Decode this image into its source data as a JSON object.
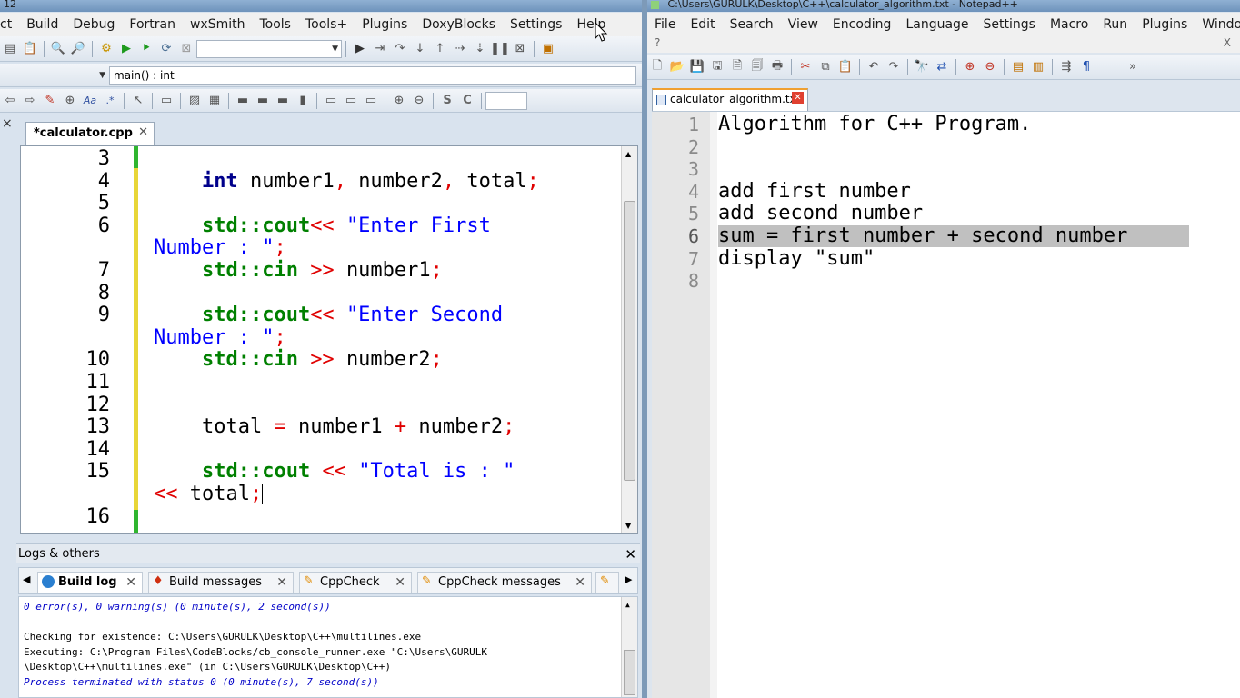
{
  "codeblocks": {
    "title_fragment": "12",
    "menu": [
      "ct",
      "Build",
      "Debug",
      "Fortran",
      "wxSmith",
      "Tools",
      "Tools+",
      "Plugins",
      "DoxyBlocks",
      "Settings",
      "Help"
    ],
    "scope_combo": "main() : int",
    "editor_tab": "*calculator.cpp",
    "code_lines": [
      {
        "num": "3",
        "tokens": []
      },
      {
        "num": "4",
        "tokens": [
          [
            "kw",
            "    int "
          ],
          [
            "txt",
            "number1"
          ],
          [
            "op",
            ", "
          ],
          [
            "txt",
            "number2"
          ],
          [
            "op",
            ", "
          ],
          [
            "txt",
            "total"
          ],
          [
            "op",
            ";"
          ]
        ]
      },
      {
        "num": "5",
        "tokens": []
      },
      {
        "num": "6",
        "tokens": [
          [
            "std",
            "    std::cout"
          ],
          [
            "op",
            "<< "
          ],
          [
            "str",
            "\"Enter First"
          ]
        ]
      },
      {
        "num": "",
        "tokens": [
          [
            "str",
            "Number : \""
          ],
          [
            "op",
            ";"
          ]
        ]
      },
      {
        "num": "7",
        "tokens": [
          [
            "std",
            "    std::cin "
          ],
          [
            "op",
            ">> "
          ],
          [
            "txt",
            "number1"
          ],
          [
            "op",
            ";"
          ]
        ]
      },
      {
        "num": "8",
        "tokens": []
      },
      {
        "num": "9",
        "tokens": [
          [
            "std",
            "    std::cout"
          ],
          [
            "op",
            "<< "
          ],
          [
            "str",
            "\"Enter Second"
          ]
        ]
      },
      {
        "num": "",
        "tokens": [
          [
            "str",
            "Number : \""
          ],
          [
            "op",
            ";"
          ]
        ]
      },
      {
        "num": "10",
        "tokens": [
          [
            "std",
            "    std::cin "
          ],
          [
            "op",
            ">> "
          ],
          [
            "txt",
            "number2"
          ],
          [
            "op",
            ";"
          ]
        ]
      },
      {
        "num": "11",
        "tokens": []
      },
      {
        "num": "12",
        "tokens": []
      },
      {
        "num": "13",
        "tokens": [
          [
            "txt",
            "    total "
          ],
          [
            "op",
            "= "
          ],
          [
            "txt",
            "number1 "
          ],
          [
            "op",
            "+ "
          ],
          [
            "txt",
            "number2"
          ],
          [
            "op",
            ";"
          ]
        ]
      },
      {
        "num": "14",
        "tokens": []
      },
      {
        "num": "15",
        "tokens": [
          [
            "std",
            "    std::cout "
          ],
          [
            "op",
            "<< "
          ],
          [
            "str",
            "\"Total is : \""
          ]
        ]
      },
      {
        "num": "",
        "tokens": [
          [
            "op",
            "<< "
          ],
          [
            "txt",
            "total"
          ],
          [
            "op",
            ";"
          ]
        ],
        "caret": true
      },
      {
        "num": "16",
        "tokens": []
      }
    ],
    "logs": {
      "header": "Logs & others",
      "tabs": [
        "Build log",
        "Build messages",
        "CppCheck",
        "CppCheck messages"
      ],
      "lines": [
        {
          "text": "0 error(s), 0 warning(s) (0 minute(s), 2 second(s))",
          "style": "blue"
        },
        {
          "text": "",
          "style": "plain"
        },
        {
          "text": "Checking for existence: C:\\Users\\GURULK\\Desktop\\C++\\multilines.exe",
          "style": "plain"
        },
        {
          "text": "Executing: C:\\Program Files\\CodeBlocks/cb_console_runner.exe \"C:\\Users\\GURULK",
          "style": "plain"
        },
        {
          "text": "\\Desktop\\C++\\multilines.exe\" (in C:\\Users\\GURULK\\Desktop\\C++)",
          "style": "plain"
        },
        {
          "text": "Process terminated with status 0 (0 minute(s), 7 second(s))",
          "style": "blue"
        }
      ]
    }
  },
  "notepad": {
    "title": "C:\\Users\\GURULK\\Desktop\\C++\\calculator_algorithm.txt - Notepad++",
    "menu": [
      "File",
      "Edit",
      "Search",
      "View",
      "Encoding",
      "Language",
      "Settings",
      "Macro",
      "Run",
      "Plugins",
      "Window"
    ],
    "menu_extra": "?",
    "close_x": "X",
    "tab": "calculator_algorithm.txt",
    "lines": [
      {
        "num": "1",
        "text": "Algorithm for C++ Program."
      },
      {
        "num": "2",
        "text": ""
      },
      {
        "num": "3",
        "text": ""
      },
      {
        "num": "4",
        "text": "add first number"
      },
      {
        "num": "5",
        "text": "add second number"
      },
      {
        "num": "6",
        "text": "sum = first number + second number"
      },
      {
        "num": "7",
        "text": "display \"sum\""
      },
      {
        "num": "8",
        "text": ""
      }
    ],
    "highlight_line": 6
  }
}
